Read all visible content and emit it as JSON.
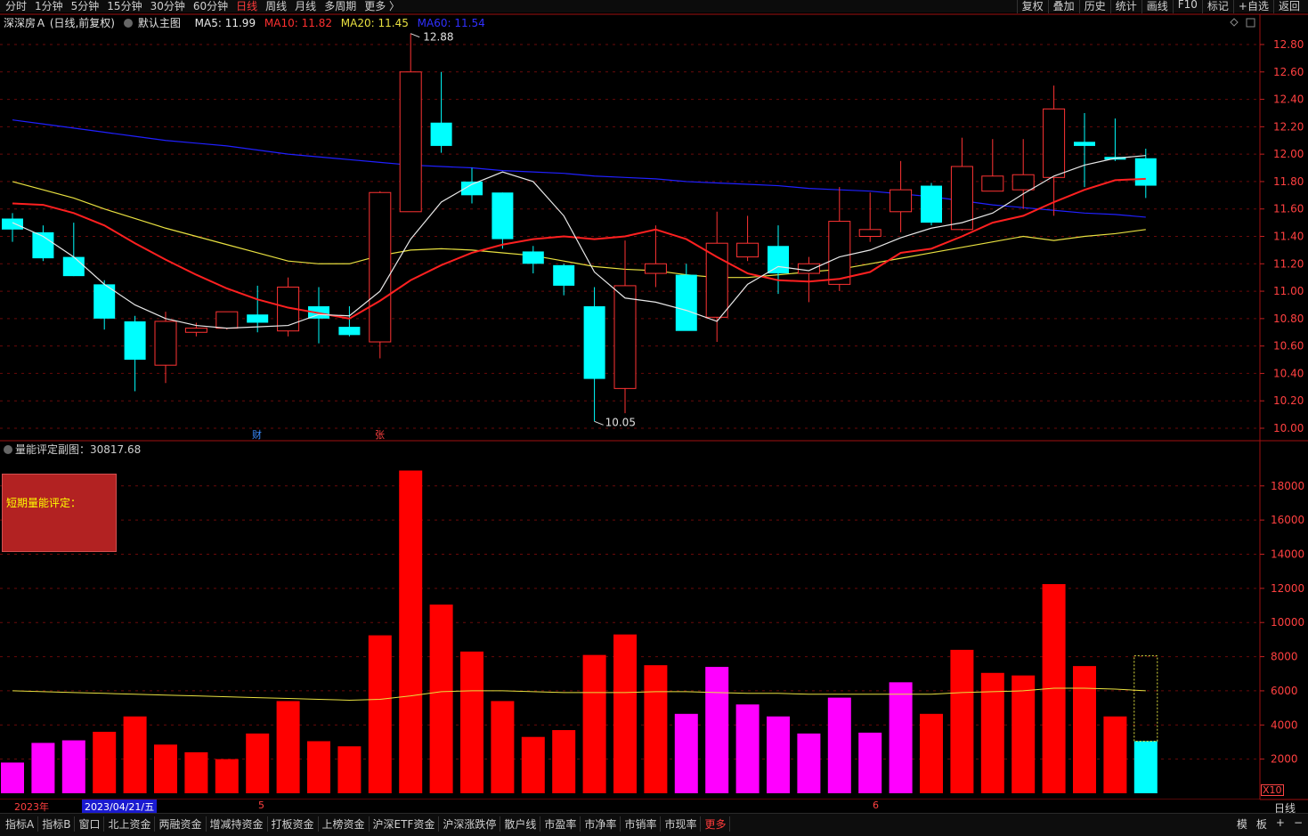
{
  "topbar": {
    "tabs": [
      "分时",
      "1分钟",
      "5分钟",
      "15分钟",
      "30分钟",
      "60分钟",
      "日线",
      "周线",
      "月线",
      "多周期",
      "更多 〉"
    ],
    "active_tab": "日线",
    "tools": [
      "复权",
      "叠加",
      "历史",
      "统计",
      "画线",
      "F10",
      "标记",
      "+自选",
      "返回"
    ]
  },
  "legend": {
    "stock": "深深房Ａ (日线,前复权)",
    "template": "默认主图",
    "ma5": "MA5: 11.99",
    "ma10": "MA10: 11.82",
    "ma20": "MA20: 11.45",
    "ma60": "MA60: 11.54"
  },
  "sub": {
    "title": "量能评定副图：30817.68",
    "box_label": "短期量能评定："
  },
  "marks": {
    "cai": "财",
    "zhang": "张"
  },
  "colors": {
    "up": "#ff3333",
    "down": "#00ffff",
    "ma5": "#e8e8e8",
    "ma10": "#ff2020",
    "ma20": "#e8e040",
    "ma60": "#2020ff",
    "vol_up": "#ff0000",
    "vol_mag": "#ff00ff",
    "vol_last": "#00ffff"
  },
  "date_bar": {
    "year": "2023年",
    "cursor_date": "2023/04/21/五",
    "month5": "5",
    "month6": "6"
  },
  "right_label": "日线",
  "scale": "X10",
  "bottombar": {
    "items": [
      "指标A",
      "指标B",
      "窗口",
      "北上资金",
      "两融资金",
      "增减持资金",
      "打板资金",
      "上榜资金",
      "沪深ETF资金",
      "沪深涨跌停",
      "散户线",
      "市盈率",
      "市净率",
      "市销率",
      "市现率",
      "更多"
    ],
    "right": [
      "模",
      "板",
      "+",
      "−"
    ]
  },
  "chart_data": [
    {
      "type": "candlestick",
      "title": "深深房Ａ (日线,前复权)",
      "ylim": [
        9.9,
        12.9
      ],
      "yticks": [
        10.0,
        10.2,
        10.4,
        10.6,
        10.8,
        11.0,
        11.2,
        11.4,
        11.6,
        11.8,
        12.0,
        12.2,
        12.4,
        12.6,
        12.8
      ],
      "annotations": {
        "high": "12.88",
        "low": "10.05"
      },
      "candles": [
        {
          "o": 11.53,
          "h": 11.57,
          "l": 11.36,
          "c": 11.45
        },
        {
          "o": 11.43,
          "h": 11.48,
          "l": 11.22,
          "c": 11.24
        },
        {
          "o": 11.25,
          "h": 11.5,
          "l": 11.11,
          "c": 11.11
        },
        {
          "o": 11.05,
          "h": 11.08,
          "l": 10.72,
          "c": 10.8
        },
        {
          "o": 10.78,
          "h": 10.82,
          "l": 10.27,
          "c": 10.5
        },
        {
          "o": 10.46,
          "h": 10.85,
          "l": 10.33,
          "c": 10.78
        },
        {
          "o": 10.7,
          "h": 10.77,
          "l": 10.67,
          "c": 10.73
        },
        {
          "o": 10.73,
          "h": 10.85,
          "l": 10.72,
          "c": 10.85
        },
        {
          "o": 10.83,
          "h": 11.04,
          "l": 10.7,
          "c": 10.77
        },
        {
          "o": 10.71,
          "h": 11.1,
          "l": 10.67,
          "c": 11.03
        },
        {
          "o": 10.89,
          "h": 11.03,
          "l": 10.62,
          "c": 10.8
        },
        {
          "o": 10.74,
          "h": 10.89,
          "l": 10.67,
          "c": 10.68
        },
        {
          "o": 10.63,
          "h": 11.73,
          "l": 10.51,
          "c": 11.72
        },
        {
          "o": 11.58,
          "h": 12.88,
          "l": 11.58,
          "c": 12.6
        },
        {
          "o": 12.23,
          "h": 12.6,
          "l": 12.01,
          "c": 12.06
        },
        {
          "o": 11.8,
          "h": 11.9,
          "l": 11.64,
          "c": 11.7
        },
        {
          "o": 11.72,
          "h": 11.72,
          "l": 11.31,
          "c": 11.38
        },
        {
          "o": 11.29,
          "h": 11.33,
          "l": 11.13,
          "c": 11.2
        },
        {
          "o": 11.19,
          "h": 11.2,
          "l": 10.97,
          "c": 11.04
        },
        {
          "o": 10.89,
          "h": 11.03,
          "l": 10.05,
          "c": 10.36
        },
        {
          "o": 10.29,
          "h": 11.37,
          "l": 10.11,
          "c": 11.04
        },
        {
          "o": 11.13,
          "h": 11.48,
          "l": 11.03,
          "c": 11.2
        },
        {
          "o": 11.12,
          "h": 11.2,
          "l": 10.76,
          "c": 10.71
        },
        {
          "o": 10.81,
          "h": 11.58,
          "l": 10.63,
          "c": 11.35
        },
        {
          "o": 11.25,
          "h": 11.55,
          "l": 11.22,
          "c": 11.35
        },
        {
          "o": 11.33,
          "h": 11.48,
          "l": 10.98,
          "c": 11.13
        },
        {
          "o": 11.13,
          "h": 11.25,
          "l": 10.92,
          "c": 11.2
        },
        {
          "o": 11.05,
          "h": 11.76,
          "l": 11.0,
          "c": 11.51
        },
        {
          "o": 11.4,
          "h": 11.72,
          "l": 11.36,
          "c": 11.45
        },
        {
          "o": 11.58,
          "h": 11.95,
          "l": 11.43,
          "c": 11.74
        },
        {
          "o": 11.77,
          "h": 11.79,
          "l": 11.48,
          "c": 11.5
        },
        {
          "o": 11.45,
          "h": 12.12,
          "l": 11.44,
          "c": 11.91
        },
        {
          "o": 11.73,
          "h": 12.11,
          "l": 11.73,
          "c": 11.84
        },
        {
          "o": 11.74,
          "h": 12.11,
          "l": 11.6,
          "c": 11.85
        },
        {
          "o": 11.83,
          "h": 12.5,
          "l": 11.55,
          "c": 12.33
        },
        {
          "o": 12.09,
          "h": 12.3,
          "l": 11.76,
          "c": 12.06
        },
        {
          "o": 11.98,
          "h": 12.26,
          "l": 11.95,
          "c": 11.96
        },
        {
          "o": 11.97,
          "h": 12.04,
          "l": 11.68,
          "c": 11.77
        }
      ],
      "ma5": [
        11.5,
        11.4,
        11.25,
        11.05,
        10.9,
        10.8,
        10.75,
        10.73,
        10.74,
        10.75,
        10.83,
        10.82,
        11.0,
        11.38,
        11.65,
        11.78,
        11.87,
        11.8,
        11.55,
        11.14,
        10.95,
        10.92,
        10.86,
        10.78,
        11.05,
        11.18,
        11.15,
        11.25,
        11.3,
        11.39,
        11.46,
        11.5,
        11.57,
        11.71,
        11.84,
        11.92,
        11.97,
        11.99
      ],
      "ma10": [
        11.64,
        11.63,
        11.57,
        11.48,
        11.35,
        11.23,
        11.12,
        11.02,
        10.94,
        10.88,
        10.84,
        10.8,
        10.93,
        11.08,
        11.19,
        11.28,
        11.34,
        11.38,
        11.4,
        11.38,
        11.4,
        11.45,
        11.38,
        11.25,
        11.13,
        11.08,
        11.07,
        11.09,
        11.14,
        11.28,
        11.31,
        11.4,
        11.5,
        11.55,
        11.65,
        11.74,
        11.81,
        11.82
      ],
      "ma20": [
        11.8,
        11.74,
        11.68,
        11.6,
        11.53,
        11.46,
        11.4,
        11.34,
        11.28,
        11.22,
        11.2,
        11.2,
        11.26,
        11.3,
        11.31,
        11.3,
        11.28,
        11.26,
        11.22,
        11.18,
        11.16,
        11.15,
        11.12,
        11.1,
        11.1,
        11.12,
        11.14,
        11.16,
        11.2,
        11.24,
        11.28,
        11.32,
        11.36,
        11.4,
        11.37,
        11.4,
        11.42,
        11.45
      ],
      "ma60": [
        12.25,
        12.22,
        12.19,
        12.16,
        12.13,
        12.1,
        12.08,
        12.06,
        12.03,
        12.0,
        11.98,
        11.96,
        11.94,
        11.92,
        11.91,
        11.9,
        11.88,
        11.87,
        11.86,
        11.84,
        11.83,
        11.82,
        11.8,
        11.79,
        11.78,
        11.77,
        11.75,
        11.74,
        11.73,
        11.71,
        11.69,
        11.66,
        11.63,
        11.61,
        11.59,
        11.57,
        11.56,
        11.54
      ]
    },
    {
      "type": "bar",
      "title": "量能评定副图：30817.68",
      "ylim": [
        0,
        19500
      ],
      "yticks": [
        2000,
        4000,
        6000,
        8000,
        10000,
        12000,
        14000,
        16000,
        18000
      ],
      "values": [
        1800,
        2950,
        3100,
        3600,
        4500,
        2850,
        2400,
        2000,
        3500,
        5400,
        3050,
        2750,
        9250,
        18900,
        11050,
        8300,
        5400,
        3300,
        3700,
        8100,
        9300,
        7500,
        4650,
        7400,
        5200,
        4500,
        3500,
        5600,
        3550,
        6500,
        4650,
        8400,
        7050,
        6900,
        12250,
        7450,
        4500,
        3050
      ],
      "colors": [
        "mag",
        "mag",
        "mag",
        "red",
        "red",
        "red",
        "red",
        "red",
        "red",
        "red",
        "red",
        "red",
        "red",
        "red",
        "red",
        "red",
        "red",
        "red",
        "red",
        "red",
        "red",
        "red",
        "mag",
        "mag",
        "mag",
        "mag",
        "mag",
        "mag",
        "mag",
        "mag",
        "red",
        "red",
        "red",
        "red",
        "red",
        "red",
        "red",
        "cyan"
      ],
      "avg_line": [
        6000,
        5950,
        5900,
        5850,
        5800,
        5750,
        5700,
        5650,
        5600,
        5550,
        5500,
        5450,
        5500,
        5700,
        5950,
        6000,
        6000,
        5950,
        5900,
        5900,
        5900,
        5950,
        5950,
        5900,
        5850,
        5850,
        5800,
        5800,
        5800,
        5800,
        5800,
        5900,
        5950,
        6000,
        6150,
        6150,
        6100,
        6000
      ],
      "last_bar_outline": 8050
    }
  ]
}
